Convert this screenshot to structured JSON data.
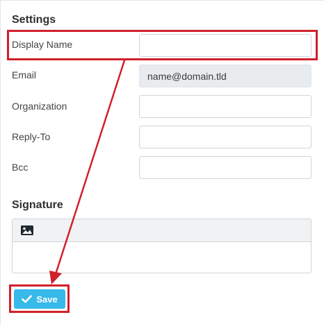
{
  "settings": {
    "title": "Settings",
    "fields": [
      {
        "label": "Display Name",
        "value": "",
        "readonly": false
      },
      {
        "label": "Email",
        "value": "name@domain.tld",
        "readonly": true
      },
      {
        "label": "Organization",
        "value": "",
        "readonly": false
      },
      {
        "label": "Reply-To",
        "value": "",
        "readonly": false
      },
      {
        "label": "Bcc",
        "value": "",
        "readonly": false
      }
    ]
  },
  "signature": {
    "title": "Signature",
    "toolbar_icon": "image-icon",
    "content": ""
  },
  "save": {
    "label": "Save",
    "icon": "checkmark-icon"
  },
  "annotations": {
    "color": "#d0202a"
  },
  "colors": {
    "save_button": "#37b9ea",
    "readonly_field": "#e9ecef"
  }
}
